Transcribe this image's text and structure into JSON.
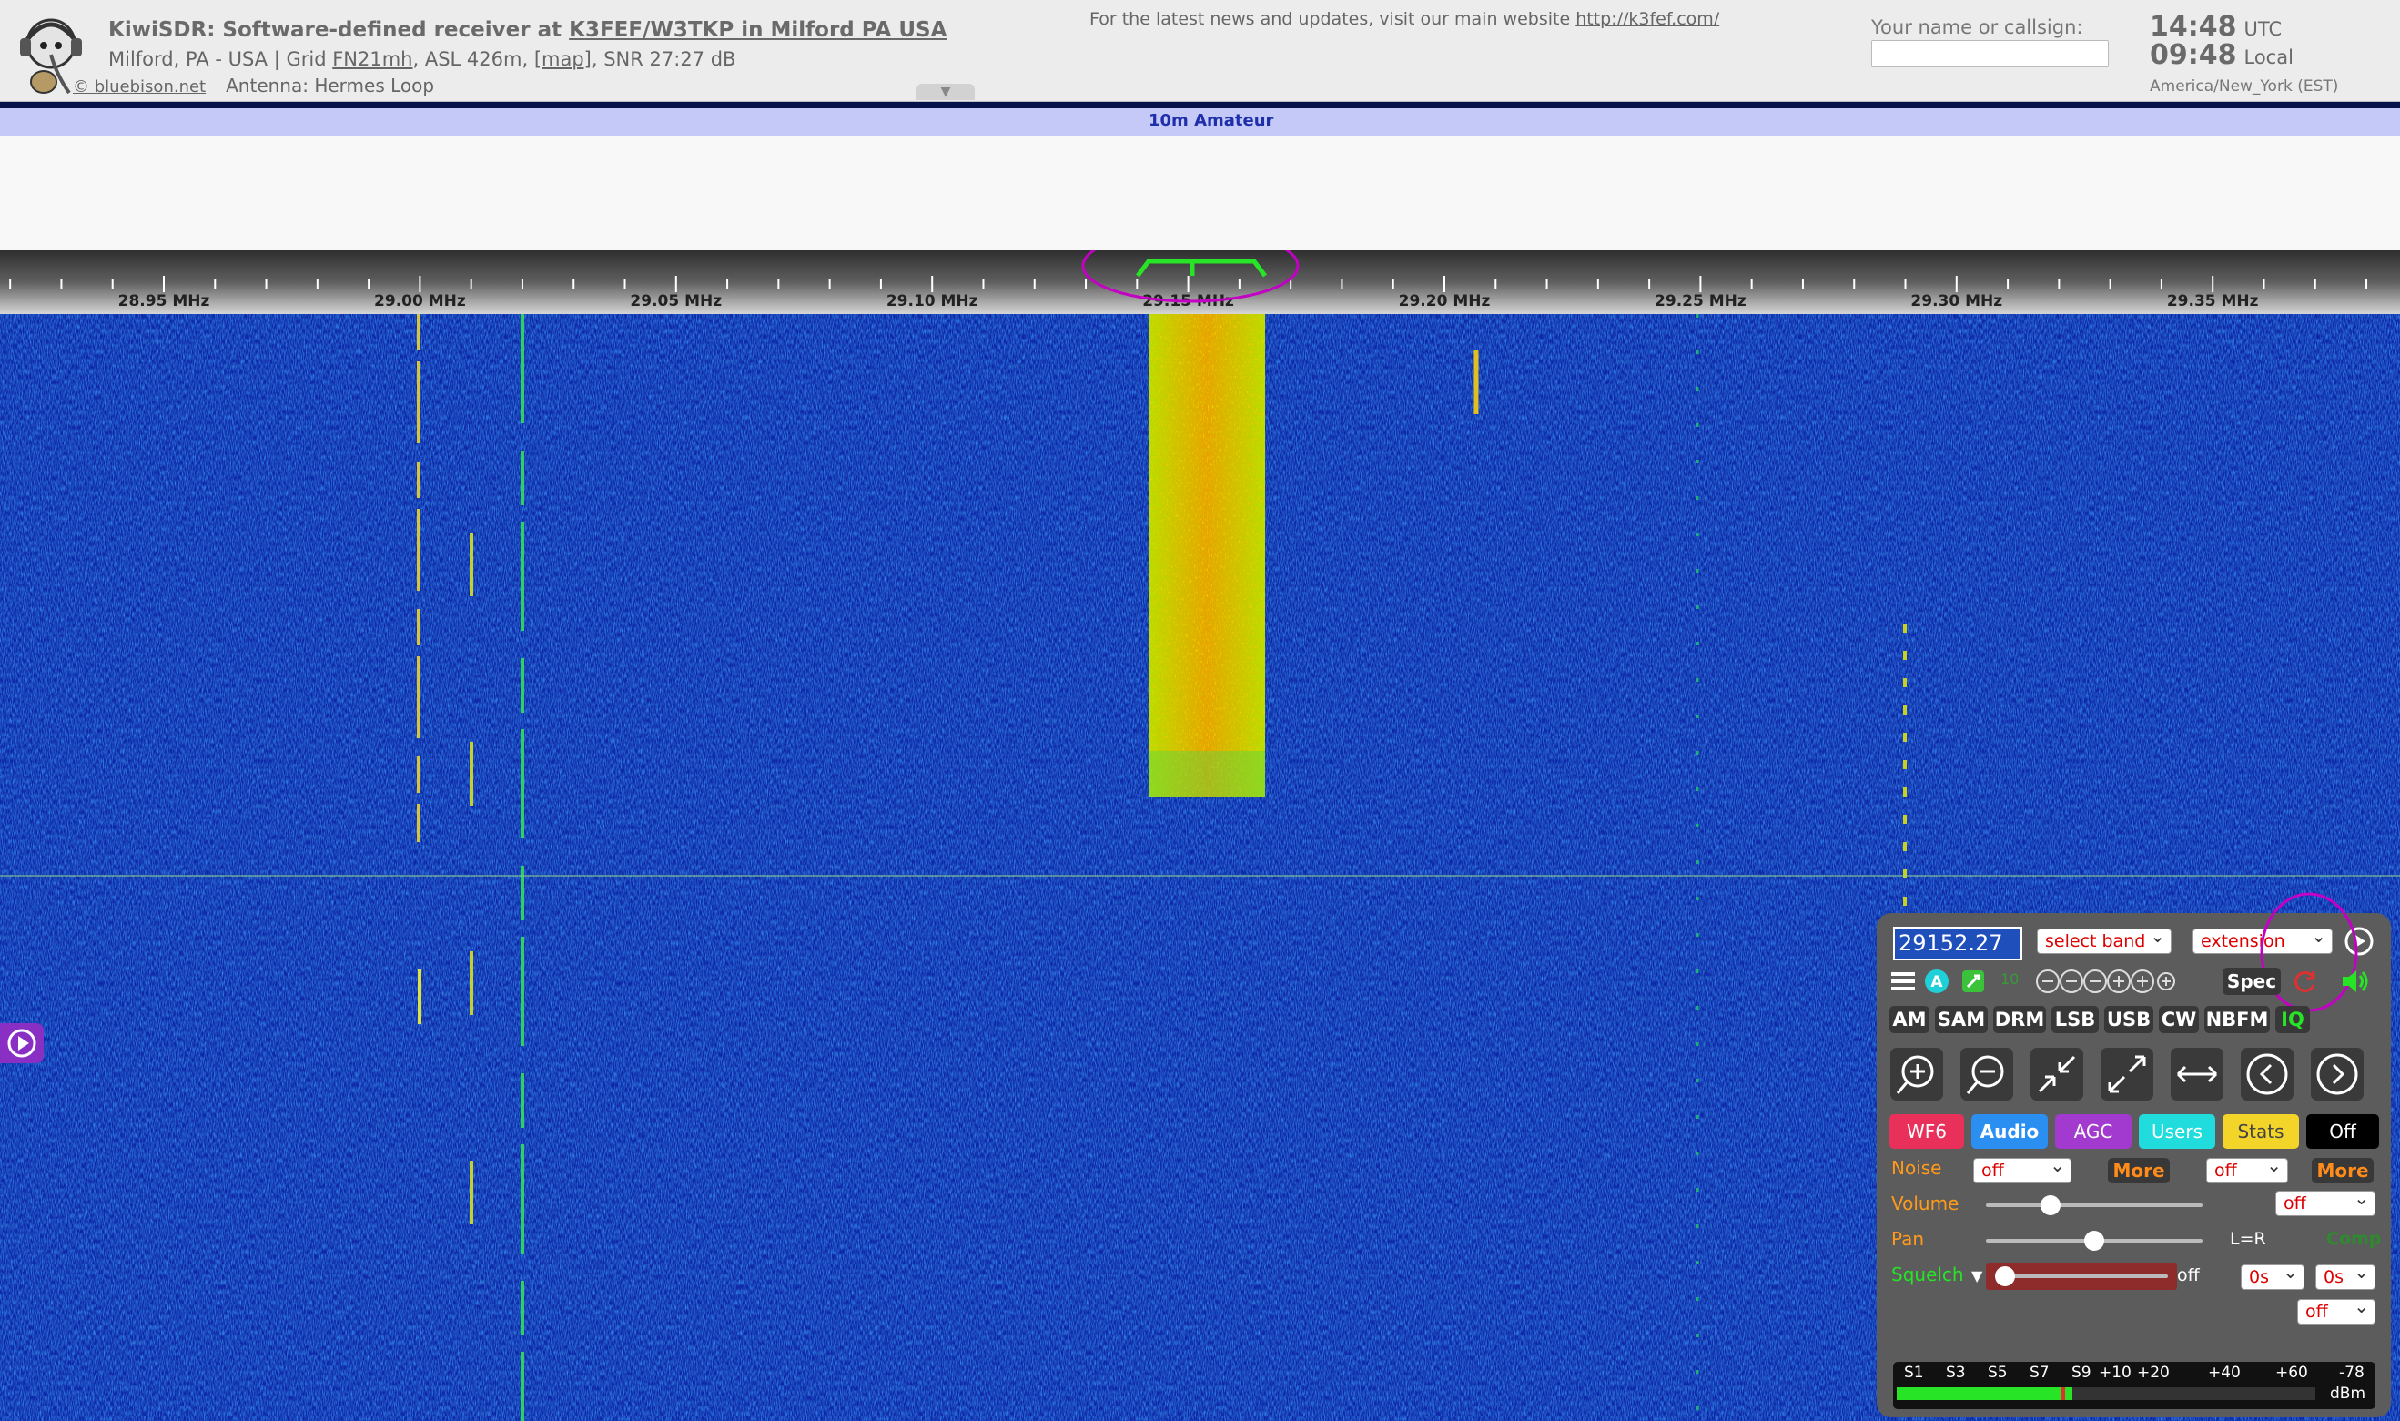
{
  "header": {
    "title_prefix": "KiwiSDR: Software-defined receiver at ",
    "title_link": "K3FEF/W3TKP in Milford PA USA",
    "location": "Milford, PA - USA | Grid ",
    "grid": "FN21mh",
    "asl": ", ASL 426m, ",
    "map": "[map]",
    "snr": ", SNR 27:27 dB",
    "copyright": "© bluebison.net",
    "antenna": "Antenna: Hermes Loop",
    "news_text": "For the latest news and updates, visit our main website ",
    "news_link": "http://k3fef.com/",
    "ident_label": "Your name or callsign:",
    "utc_time": "14:48",
    "utc_label": "UTC",
    "local_time": "09:48",
    "local_label": "Local",
    "timezone": "America/New_York (EST)"
  },
  "band_label": "10m Amateur",
  "scale": {
    "labels": [
      "28.95 MHz",
      "29.00 MHz",
      "29.05 MHz",
      "29.10 MHz",
      "29.15 MHz",
      "29.20 MHz",
      "29.25 MHz",
      "29.30 MHz",
      "29.35 MHz"
    ]
  },
  "panel": {
    "frequency": "29152.27",
    "select_band": "select band",
    "extension": "extension",
    "spec_label": "Spec",
    "ten_label": "10",
    "modes": [
      "AM",
      "SAM",
      "DRM",
      "LSB",
      "USB",
      "CW",
      "NBFM",
      "IQ"
    ],
    "tabs": [
      "WF6",
      "Audio",
      "AGC",
      "Users",
      "Stats",
      "Off"
    ],
    "noise_label": "Noise",
    "noise_value": "off",
    "noise_more": "More",
    "noise2_value": "off",
    "noise2_more": "More",
    "volume_label": "Volume",
    "volume_select": "off",
    "volume_level": 0.3,
    "pan_label": "Pan",
    "pan_value": "L=R",
    "comp_label": "Comp",
    "pan_level": 0.5,
    "squelch_label": "Squelch",
    "squelch_value": "off",
    "squelch_t1": "0s",
    "squelch_t2": "0s",
    "squelch_sel": "off",
    "smeter_labels": [
      "S1",
      "S3",
      "S5",
      "S7",
      "S9",
      "+10",
      "+20",
      "+40",
      "+60"
    ],
    "smeter_dbm": "-78",
    "smeter_unit": "dBm",
    "smeter_level": 0.42
  },
  "colors": {
    "accent_purple": "#c400c4",
    "passband_green": "#27e427",
    "waterfall_bg": "#0d27a8"
  }
}
